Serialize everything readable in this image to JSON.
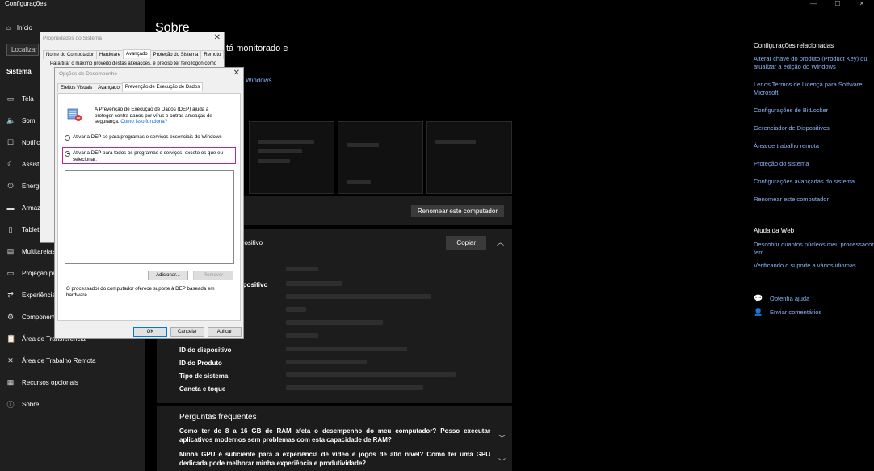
{
  "settings": {
    "window_title": "Configurações",
    "window_controls": [
      "—",
      "☐",
      "✕"
    ],
    "home": "Início",
    "search_placeholder": "Localizar",
    "section": "Sistema",
    "nav": [
      {
        "label": "Tela",
        "icon": "monitor-icon"
      },
      {
        "label": "Som",
        "icon": "speaker-icon"
      },
      {
        "label": "Notific",
        "icon": "notification-icon"
      },
      {
        "label": "Assist",
        "icon": "moon-icon"
      },
      {
        "label": "Energi",
        "icon": "power-icon"
      },
      {
        "label": "Armaz",
        "icon": "storage-icon"
      },
      {
        "label": "Tablet",
        "icon": "tablet-icon"
      },
      {
        "label": "Multitarefas",
        "icon": "multitask-icon"
      },
      {
        "label": "Projeção pa",
        "icon": "projection-icon"
      },
      {
        "label": "Experiência",
        "icon": "share-icon"
      },
      {
        "label": "Component",
        "icon": "components-icon"
      },
      {
        "label": "Área de Transferência",
        "icon": "clipboard-icon"
      },
      {
        "label": "Área de Trabalho Remota",
        "icon": "remote-icon"
      },
      {
        "label": "Recursos opcionais",
        "icon": "features-icon"
      },
      {
        "label": "Sobre",
        "icon": "info-icon"
      }
    ],
    "page_title": "Sobre",
    "monitor_text": "tá monitorado e",
    "windows_link": "Windows",
    "rename_button": "Renomear este computador",
    "specs_header": "spositivo",
    "copy_button": "Copiar",
    "spec_labels": [
      "ispositivo",
      "ID do dispositivo",
      "ID do Produto",
      "Tipo de sistema",
      "Caneta e toque"
    ],
    "faq_title": "Perguntas frequentes",
    "faq": [
      "Como ter de 8 a 16 GB de RAM afeta o desempenho do meu computador? Posso executar aplicativos modernos sem problemas com esta capacidade de RAM?",
      "Minha GPU é suficiente para a experiência de vídeo e jogos de alto nível? Como ter uma GPU dedicada pode melhorar minha experiência e produtividade?"
    ],
    "related_title": "Configurações relacionadas",
    "related_links": [
      "Alterar chave do produto (Product Key) ou atualizar a edição do Windows",
      "Ler os Termos de Licença para Software Microsoft",
      "Configurações de BitLocker",
      "Gerenciador de Dispositivos",
      "Área de trabalho remota",
      "Proteção do sistema",
      "Configurações avançadas do sistema",
      "Renomear este computador"
    ],
    "web_help_title": "Ajuda da Web",
    "web_help_links": [
      "Descobrir quantos núcleos meu processador tem",
      "Verificando o suporte a vários idiomas"
    ],
    "get_help": "Obtenha ajuda",
    "send_feedback": "Enviar comentários"
  },
  "sys_props": {
    "title": "Propriedades do Sistema",
    "tabs": [
      "Nome do Computador",
      "Hardware",
      "Avançado",
      "Proteção do Sistema",
      "Remoto"
    ],
    "selected_tab": 2,
    "note": "Para tirar o máximo proveito destas alterações, é preciso ter feito logon como"
  },
  "perf_opts": {
    "title": "Opções de Desempenho",
    "tabs": [
      "Efeitos Visuais",
      "Avançado",
      "Prevenção de Execução de Dados"
    ],
    "selected_tab": 2,
    "description": "A Prevenção de Execução de Dados (DEP) ajuda a proteger contra danos por vírus e outras ameaças de segurança.",
    "how_link": "Como isso funciona?",
    "option1": "Ativar a DEP só para programas e serviços essenciais do Windows",
    "option2": "Ativar a DEP para todos os programas e serviços, exceto os que eu selecionar:",
    "add_button": "Adicionar...",
    "remove_button": "Remover",
    "footer": "O processador do computador oferece suporte à DEP baseada em hardware.",
    "ok": "OK",
    "cancel": "Cancelar",
    "apply": "Aplicar"
  },
  "colors": {
    "accent_link": "#8ab4f8",
    "highlight": "#c0268c"
  }
}
